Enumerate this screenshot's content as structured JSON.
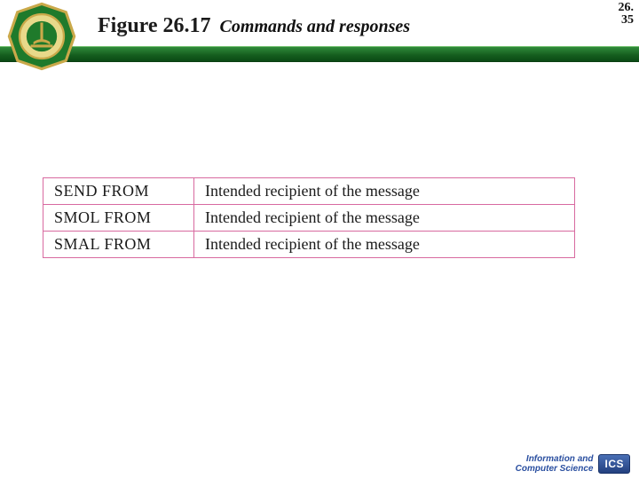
{
  "header": {
    "figure_number": "Figure 26.17",
    "figure_title": "Commands and responses",
    "page_chapter": "26.",
    "page_number": "35"
  },
  "table": {
    "rows": [
      {
        "command": "SEND FROM",
        "description": "Intended recipient of the message"
      },
      {
        "command": "SMOL FROM",
        "description": "Intended recipient of the message"
      },
      {
        "command": "SMAL FROM",
        "description": "Intended recipient of the message"
      }
    ]
  },
  "footer": {
    "dept_line1": "Information and",
    "dept_line2": "Computer Science",
    "badge": "ICS"
  },
  "colors": {
    "stripe_green": "#1f7a2b",
    "table_border": "#d86aa0",
    "badge_blue": "#2a4fa0"
  }
}
